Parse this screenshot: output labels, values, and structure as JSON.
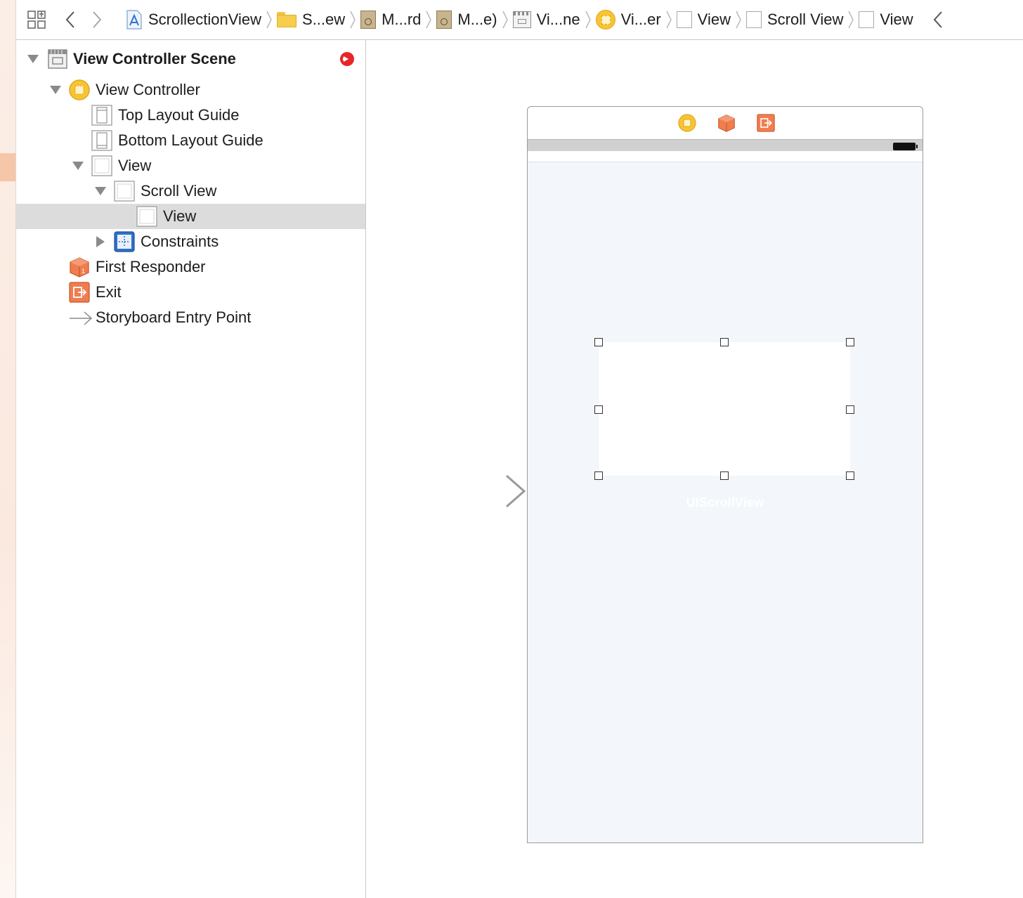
{
  "jumpbar": {
    "crumbs": [
      {
        "label": "ScrollectionView",
        "icon": "xcode-project-icon"
      },
      {
        "label": "S...ew",
        "icon": "folder-icon"
      },
      {
        "label": "M...rd",
        "icon": "storyboard-file-icon"
      },
      {
        "label": "M...e)",
        "icon": "storyboard-file-icon"
      },
      {
        "label": "Vi...ne",
        "icon": "scene-icon"
      },
      {
        "label": "Vi...er",
        "icon": "view-controller-icon"
      },
      {
        "label": "View",
        "icon": "view-icon"
      },
      {
        "label": "Scroll View",
        "icon": "view-icon"
      },
      {
        "label": "View",
        "icon": "view-icon"
      }
    ]
  },
  "outline": {
    "scene_title": "View Controller Scene",
    "items": [
      {
        "label": "View Controller",
        "icon": "view-controller-icon"
      },
      {
        "label": "Top Layout Guide",
        "icon": "top-layout-guide-icon"
      },
      {
        "label": "Bottom Layout Guide",
        "icon": "bottom-layout-guide-icon"
      },
      {
        "label": "View",
        "icon": "view-icon"
      },
      {
        "label": "Scroll View",
        "icon": "view-icon"
      },
      {
        "label": "View",
        "icon": "view-icon",
        "selected": true
      },
      {
        "label": "Constraints",
        "icon": "constraints-icon"
      },
      {
        "label": "First Responder",
        "icon": "first-responder-icon"
      },
      {
        "label": "Exit",
        "icon": "exit-icon"
      },
      {
        "label": "Storyboard Entry Point",
        "icon": "entry-arrow-icon"
      }
    ]
  },
  "canvas": {
    "scroll_view_label": "UIScrollView"
  },
  "colors": {
    "selection": "#dcdcdc",
    "view_controller": "#f7c434",
    "first_responder": "#f07d4f",
    "exit": "#f07d4f",
    "constraints": "#2f6fc9",
    "warning": "#e8262a",
    "canvas_view": "#f3f6fb"
  }
}
